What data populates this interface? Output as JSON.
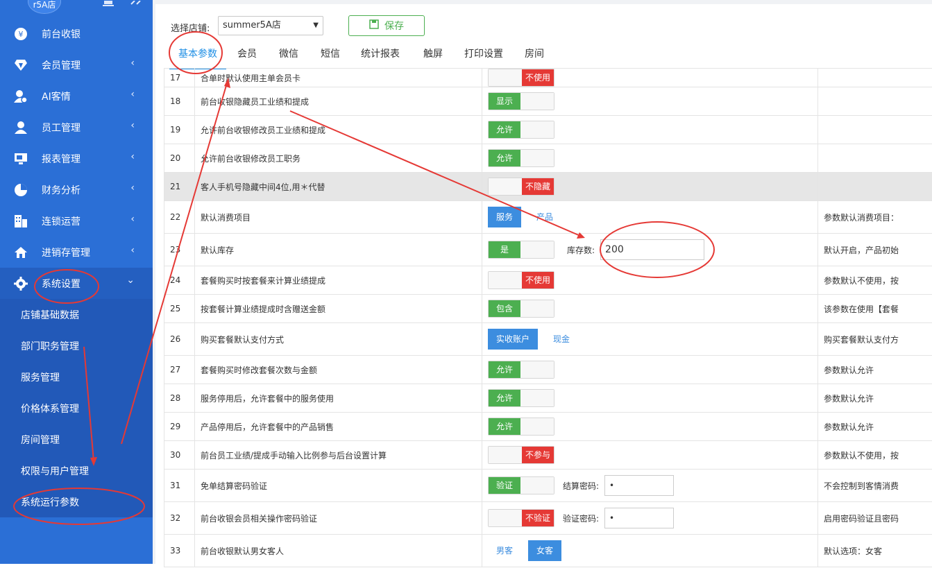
{
  "sidebar": {
    "store_chip": "r5A店",
    "menu": [
      {
        "label": "前台收银",
        "icon": "yen-icon"
      },
      {
        "label": "会员管理",
        "icon": "diamond-icon"
      },
      {
        "label": "AI客情",
        "icon": "user-heart-icon"
      },
      {
        "label": "员工管理",
        "icon": "user-icon"
      },
      {
        "label": "报表管理",
        "icon": "monitor-icon"
      },
      {
        "label": "财务分析",
        "icon": "pie-icon"
      },
      {
        "label": "连锁运营",
        "icon": "building-icon"
      },
      {
        "label": "进销存管理",
        "icon": "house-icon"
      },
      {
        "label": "系统设置",
        "icon": "gear-icon"
      }
    ],
    "submenu": [
      "店铺基础数据",
      "部门职务管理",
      "服务管理",
      "价格体系管理",
      "房间管理",
      "权限与用户管理",
      "系统运行参数"
    ]
  },
  "toolbar": {
    "store_label": "选择店铺:",
    "store_value": "summer5A店",
    "save_label": "保存"
  },
  "tabs": [
    "基本参数",
    "会员",
    "微信",
    "短信",
    "统计报表",
    "触屏",
    "打印设置",
    "房间"
  ],
  "rows": [
    {
      "no": "17",
      "name": "合单时默认使用主单会员卡",
      "switch": "off",
      "label": "不使用",
      "note": ""
    },
    {
      "no": "18",
      "name": "前台收银隐藏员工业绩和提成",
      "switch": "on",
      "label": "显示",
      "note": ""
    },
    {
      "no": "19",
      "name": "允许前台收银修改员工业绩和提成",
      "switch": "on",
      "label": "允许",
      "note": ""
    },
    {
      "no": "20",
      "name": "允许前台收银修改员工职务",
      "switch": "on",
      "label": "允许",
      "note": ""
    },
    {
      "no": "21",
      "name": "客人手机号隐藏中间4位,用＊代替",
      "switch": "off",
      "label": "不隐藏",
      "note": ""
    },
    {
      "no": "22",
      "name": "默认消费项目",
      "opt_sel": "服务",
      "opt_other": "产品",
      "note": "参数默认消费项目："
    },
    {
      "no": "23",
      "name": "默认库存",
      "switch": "on",
      "label": "是",
      "field_label": "库存数:",
      "field_value": "200",
      "note": "默认开启，产品初始"
    },
    {
      "no": "24",
      "name": "套餐购买时按套餐来计算业绩提成",
      "switch": "off",
      "label": "不使用",
      "note": "参数默认不使用，按"
    },
    {
      "no": "25",
      "name": "按套餐计算业绩提成时含赠送金额",
      "switch": "on",
      "label": "包含",
      "note": "该参数在使用【套餐"
    },
    {
      "no": "26",
      "name": "购买套餐默认支付方式",
      "opt_sel": "实收账户",
      "opt_other": "现金",
      "note": "购买套餐默认支付方"
    },
    {
      "no": "27",
      "name": "套餐购买时修改套餐次数与金额",
      "switch": "on",
      "label": "允许",
      "note": "参数默认允许"
    },
    {
      "no": "28",
      "name": "服务停用后，允许套餐中的服务使用",
      "switch": "on",
      "label": "允许",
      "note": "参数默认允许"
    },
    {
      "no": "29",
      "name": "产品停用后，允许套餐中的产品销售",
      "switch": "on",
      "label": "允许",
      "note": "参数默认允许"
    },
    {
      "no": "30",
      "name": "前台员工业绩/提成手动输入比例参与后台设置计算",
      "switch": "off",
      "label": "不参与",
      "note": "参数默认不使用，按"
    },
    {
      "no": "31",
      "name": "免单结算密码验证",
      "switch": "on",
      "label": "验证",
      "field_label": "结算密码:",
      "field_value": "•",
      "note": "不会控制到客情消费"
    },
    {
      "no": "32",
      "name": "前台收银会员相关操作密码验证",
      "switch": "off",
      "label": "不验证",
      "field_label": "验证密码:",
      "field_value": "•",
      "note": "启用密码验证且密码"
    },
    {
      "no": "33",
      "name": "前台收银默认男女客人",
      "opt_first": "男客",
      "opt_sel": "女客",
      "note": "默认选项：女客"
    }
  ],
  "colors": {
    "sidebar": "#2b6fd6",
    "accent": "#1f8fe5",
    "on": "#4caf50",
    "off": "#e53935",
    "annotation": "#e53935"
  }
}
